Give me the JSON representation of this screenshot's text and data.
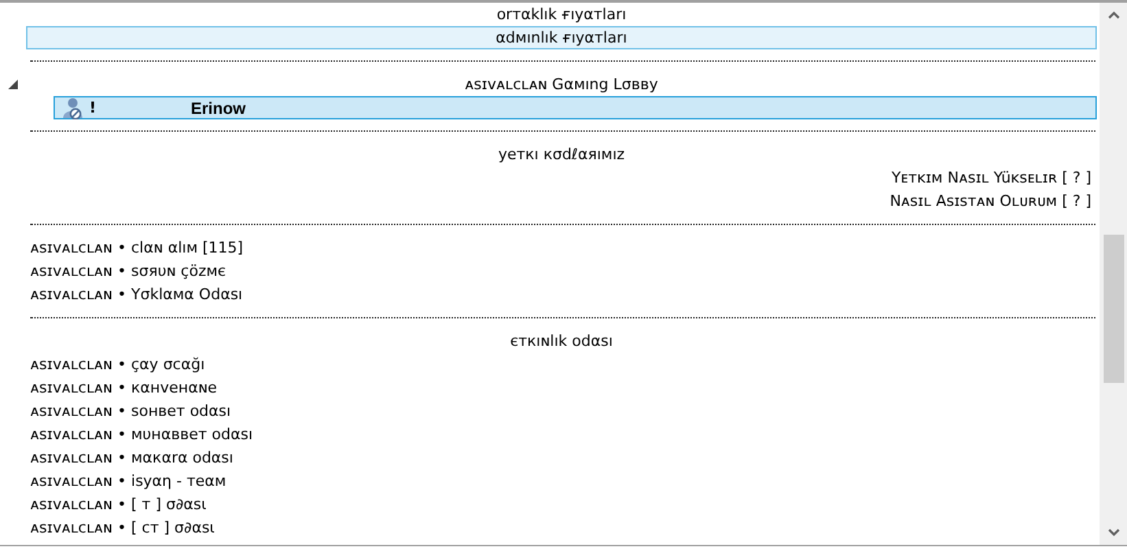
{
  "channel_tree": [
    {
      "kind": "center",
      "text": "orтαklık ғıyαтları",
      "selected": false,
      "hovered": false
    },
    {
      "kind": "center",
      "text": "αdмınlık ғıyαтları",
      "selected": false,
      "hovered": true
    },
    {
      "kind": "spacer"
    },
    {
      "kind": "center",
      "text": "ᴀsɪᴠᴀʟᴄʟᴀɴ Gαмıng Lσвву",
      "selected": false,
      "hovered": false,
      "expanded": true
    },
    {
      "kind": "client",
      "status": "!",
      "name": "Erinow",
      "selected": true,
      "hovered": false
    },
    {
      "kind": "spacer"
    },
    {
      "kind": "center",
      "text": "yeткı кσdℓαяıмız",
      "selected": false,
      "hovered": false
    },
    {
      "kind": "right",
      "text": "Yᴇᴛᴋɪᴍ Nᴀsɪʟ Yüᴋsᴇʟɪʀ [ ? ]",
      "selected": false,
      "hovered": false
    },
    {
      "kind": "right",
      "text": "Nᴀsɪʟ Asɪsᴛᴀɴ Oʟᴜʀᴜᴍ [ ? ]",
      "selected": false,
      "hovered": false
    },
    {
      "kind": "spacer"
    },
    {
      "kind": "left",
      "text": "ᴀsɪᴠᴀʟᴄʟᴀɴ • clαɴ αlıм [115]",
      "selected": false,
      "hovered": false
    },
    {
      "kind": "left",
      "text": "ᴀsɪᴠᴀʟᴄʟᴀɴ • sσяυɴ çözмє",
      "selected": false,
      "hovered": false
    },
    {
      "kind": "left",
      "text": "ᴀsɪᴠᴀʟᴄʟᴀɴ • Yσklαмα Odαsı",
      "selected": false,
      "hovered": false
    },
    {
      "kind": "spacer"
    },
    {
      "kind": "center",
      "text": "єткıɴlık odαsı",
      "selected": false,
      "hovered": false
    },
    {
      "kind": "left",
      "text": "ᴀsɪᴠᴀʟᴄʟᴀɴ  • çαy σcαğı",
      "selected": false,
      "hovered": false
    },
    {
      "kind": "left",
      "text": "ᴀsɪᴠᴀʟᴄʟᴀɴ • кαнveнαɴe",
      "selected": false,
      "hovered": false
    },
    {
      "kind": "left",
      "text": "ᴀsɪᴠᴀʟᴄʟᴀɴ • sонвeт odαsı",
      "selected": false,
      "hovered": false
    },
    {
      "kind": "left",
      "text": "ᴀsɪᴠᴀʟᴄʟᴀɴ • мυнαввeт odαsı",
      "selected": false,
      "hovered": false
    },
    {
      "kind": "left",
      "text": "ᴀsɪᴠᴀʟᴄʟᴀɴ • мαкαrα odαsı",
      "selected": false,
      "hovered": false
    },
    {
      "kind": "left",
      "text": "ᴀsɪᴠᴀʟᴄʟᴀɴ • isyαη - тeαм",
      "selected": false,
      "hovered": false
    },
    {
      "kind": "left",
      "text": "ᴀsɪᴠᴀʟᴄʟᴀɴ • [ т ] σ∂αsι",
      "selected": false,
      "hovered": false
    },
    {
      "kind": "left",
      "text": "ᴀsɪᴠᴀʟᴄʟᴀɴ • [ ст ] σ∂αsι",
      "selected": false,
      "hovered": false
    }
  ]
}
